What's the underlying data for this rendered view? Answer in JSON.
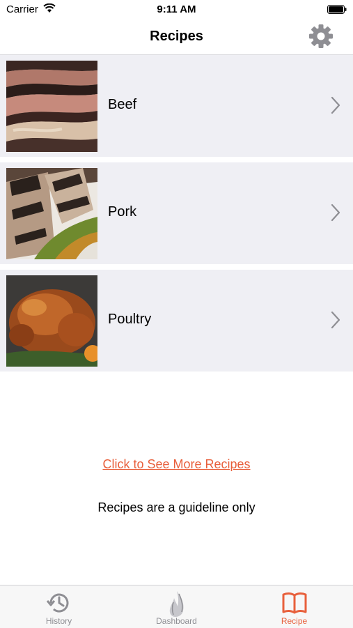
{
  "status_bar": {
    "carrier": "Carrier",
    "time": "9:11 AM"
  },
  "nav": {
    "title": "Recipes",
    "settings_icon": "gear-icon"
  },
  "categories": [
    {
      "label": "Beef",
      "image": "beef-brisket-photo"
    },
    {
      "label": "Pork",
      "image": "grilled-pork-photo"
    },
    {
      "label": "Poultry",
      "image": "roast-turkey-photo"
    }
  ],
  "more_link": "Click to See More Recipes",
  "disclaimer": "Recipes are a guideline only",
  "tabs": [
    {
      "label": "History",
      "icon": "history-icon",
      "active": false
    },
    {
      "label": "Dashboard",
      "icon": "flame-icon",
      "active": false
    },
    {
      "label": "Recipe",
      "icon": "book-icon",
      "active": true
    }
  ],
  "colors": {
    "accent": "#e8603c",
    "row_bg": "#efeff4",
    "inactive_tab": "#8e8e93"
  }
}
